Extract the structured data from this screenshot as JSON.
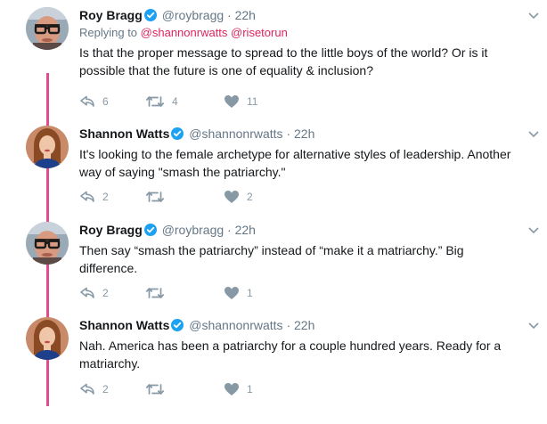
{
  "tweets": [
    {
      "name": "Roy Bragg",
      "handle": "@roybragg",
      "separator": "·",
      "time": "22h",
      "reply_prefix": "Replying to",
      "reply_handles": "@shannonrwatts @risetorun",
      "text": "Is that the proper message to spread to the little boys of the world? Or is it possible that the future is one of equality & inclusion?",
      "replies": "6",
      "retweets": "4",
      "likes": "11",
      "avatar_icon": "man-with-glasses-avatar"
    },
    {
      "name": "Shannon Watts",
      "handle": "@shannonrwatts",
      "separator": "·",
      "time": "22h",
      "text": "It's looking to the female archetype for alternative styles of leadership. Another way of saying \"smash the patriarchy.\"",
      "replies": "2",
      "retweets": "",
      "likes": "2",
      "avatar_icon": "woman-portrait-avatar"
    },
    {
      "name": "Roy Bragg",
      "handle": "@roybragg",
      "separator": "·",
      "time": "22h",
      "text": "Then say “smash the patriarchy” instead of “make it a matriarchy.” Big difference.",
      "replies": "2",
      "retweets": "",
      "likes": "1",
      "avatar_icon": "man-with-glasses-avatar"
    },
    {
      "name": "Shannon Watts",
      "handle": "@shannonrwatts",
      "separator": "·",
      "time": "22h",
      "text": "Nah. America has been a patriarchy for a couple hundred years. Ready for a matriarchy.",
      "replies": "2",
      "retweets": "",
      "likes": "1",
      "avatar_icon": "woman-portrait-avatar"
    }
  ],
  "colors": {
    "thread_line": "#e24b8d",
    "link": "#e0245e",
    "verified": "#1da1f2",
    "muted": "#657786",
    "action": "#8899a6"
  }
}
